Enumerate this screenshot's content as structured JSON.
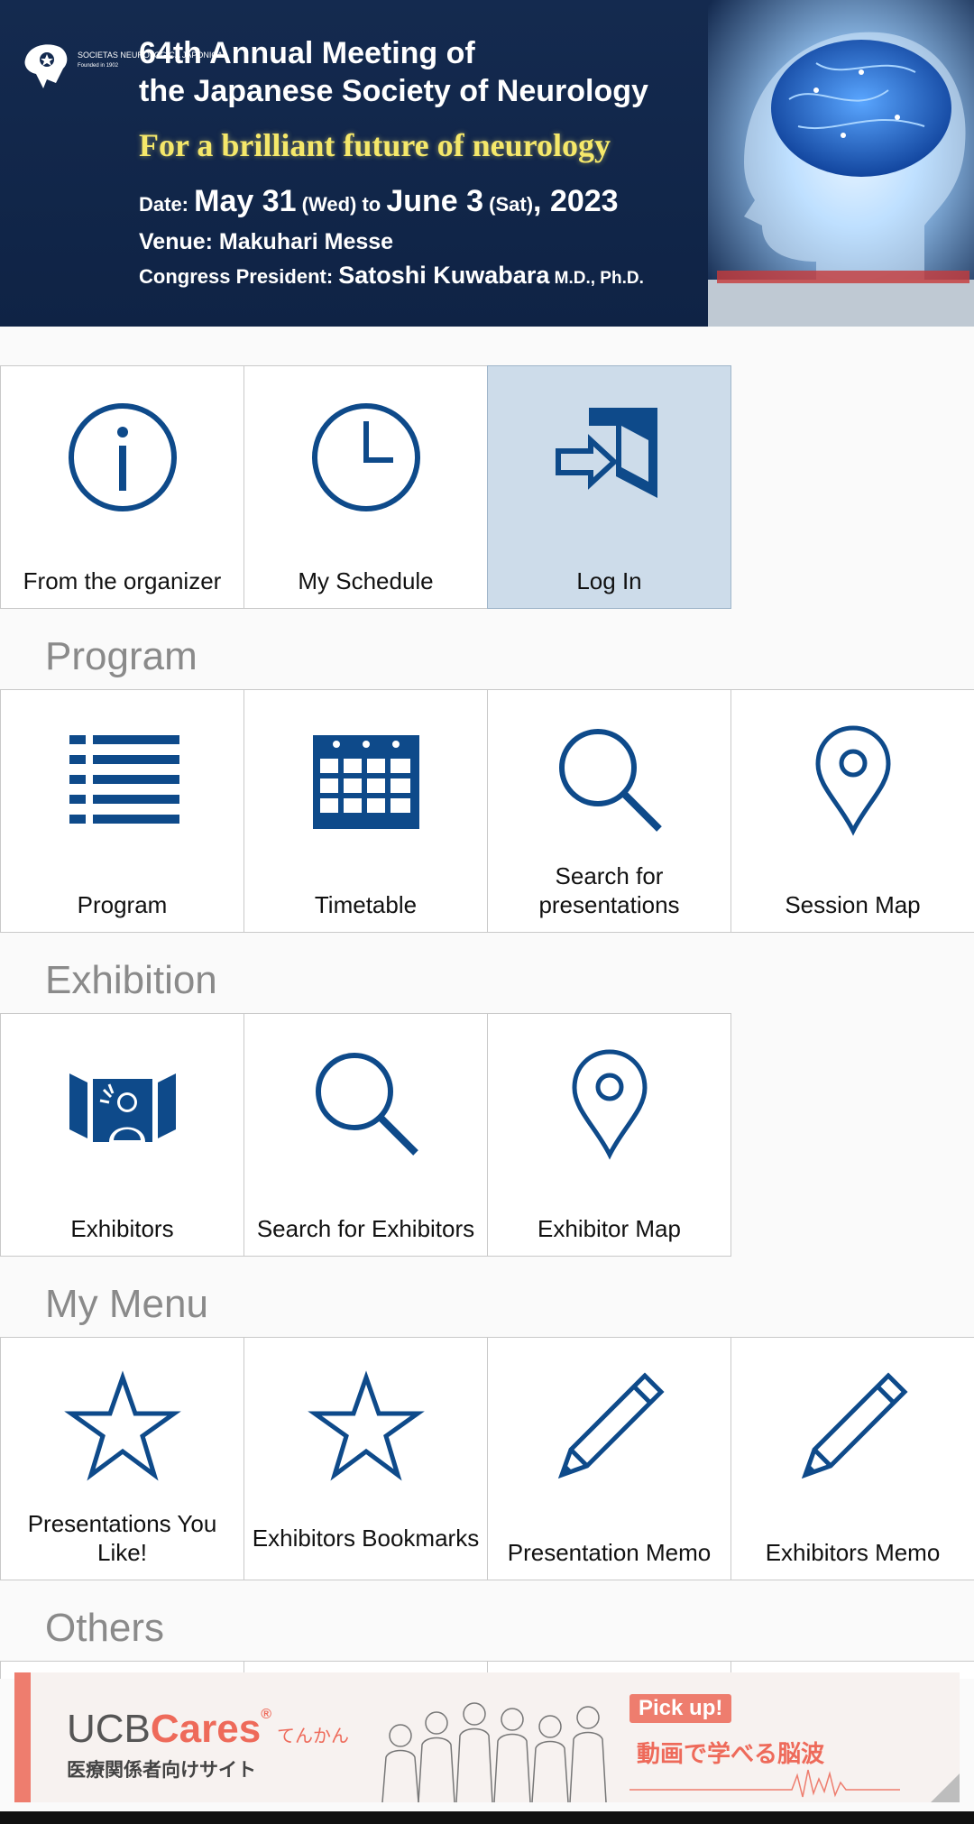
{
  "banner": {
    "logo_text": "SOCIETAS NEUROLOGICA JAPONICA",
    "logo_founded": "Founded in 1902",
    "title_line1": "64th Annual Meeting of",
    "title_line2": "the Japanese Society of Neurology",
    "tagline": "For a brilliant future of neurology",
    "date_prefix": "Date: ",
    "date_start": "May 31",
    "date_start_day": " (Wed) to ",
    "date_end": "June 3",
    "date_end_day": " (Sat)",
    "date_year": ", 2023",
    "venue_prefix": "Venue: ",
    "venue": "Makuhari Messe",
    "president_prefix": "Congress President: ",
    "president": "Satoshi Kuwabara",
    "president_degree": " M.D., Ph.D."
  },
  "top_menu": {
    "organizer": "From the organizer",
    "schedule": "My Schedule",
    "login": "Log In"
  },
  "sections": {
    "program": {
      "title": "Program",
      "items": [
        "Program",
        "Timetable",
        "Search for presentations",
        "Session Map"
      ]
    },
    "exhibition": {
      "title": "Exhibition",
      "items": [
        "Exhibitors",
        "Search for Exhibitors",
        "Exhibitor Map"
      ]
    },
    "my_menu": {
      "title": "My Menu",
      "items": [
        "Presentations You Like!",
        "Exhibitors Bookmarks",
        "Presentation Memo",
        "Exhibitors Memo"
      ]
    },
    "others": {
      "title": "Others"
    }
  },
  "ad": {
    "brand_u": "UCB",
    "brand_c": "Cares",
    "brand_r": "®",
    "brand_t": "てんかん",
    "sub": "医療関係者向けサイト",
    "pick": "Pick up!",
    "pick_sub": "動画で学べる脳波"
  },
  "colors": {
    "icon": "#0e4a8a",
    "active_tile": "#cddcea",
    "banner_bg": "#142a4f",
    "accent_ad": "#ee7d6e"
  }
}
